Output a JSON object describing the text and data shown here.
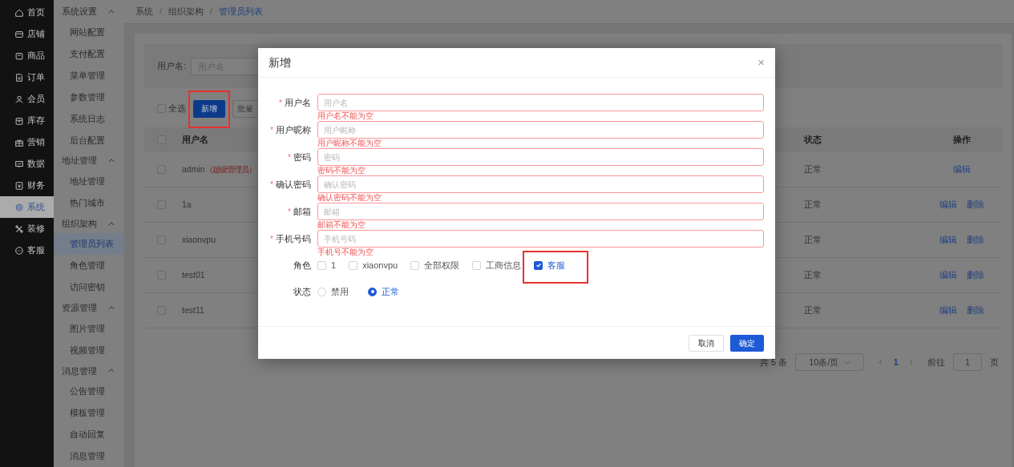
{
  "sidebar": {
    "items": [
      {
        "label": "首页",
        "selected": false
      },
      {
        "label": "店铺",
        "selected": false
      },
      {
        "label": "商品",
        "selected": false
      },
      {
        "label": "订单",
        "selected": false
      },
      {
        "label": "会员",
        "selected": false
      },
      {
        "label": "库存",
        "selected": false
      },
      {
        "label": "营销",
        "selected": false
      },
      {
        "label": "数据",
        "selected": false
      },
      {
        "label": "财务",
        "selected": false
      },
      {
        "label": "系统",
        "selected": true
      },
      {
        "label": "装修",
        "selected": false
      },
      {
        "label": "客服",
        "selected": false
      }
    ]
  },
  "submenu": {
    "groups": [
      {
        "label": "系统设置",
        "expanded": true,
        "items": [
          {
            "label": "网站配置",
            "selected": false
          },
          {
            "label": "支付配置",
            "selected": false
          },
          {
            "label": "菜单管理",
            "selected": false
          },
          {
            "label": "参数管理",
            "selected": false
          },
          {
            "label": "系统日志",
            "selected": false
          },
          {
            "label": "后台配置",
            "selected": false
          }
        ]
      },
      {
        "label": "地址管理",
        "expanded": true,
        "items": [
          {
            "label": "地址管理",
            "selected": false
          },
          {
            "label": "热门城市",
            "selected": false
          }
        ]
      },
      {
        "label": "组织架构",
        "expanded": true,
        "items": [
          {
            "label": "管理员列表",
            "selected": true
          },
          {
            "label": "角色管理",
            "selected": false
          },
          {
            "label": "访问密钥",
            "selected": false
          }
        ]
      },
      {
        "label": "资源管理",
        "expanded": true,
        "items": [
          {
            "label": "图片管理",
            "selected": false
          },
          {
            "label": "视频管理",
            "selected": false
          }
        ]
      },
      {
        "label": "消息管理",
        "expanded": true,
        "items": [
          {
            "label": "公告管理",
            "selected": false
          },
          {
            "label": "模板管理",
            "selected": false
          },
          {
            "label": "自动回复",
            "selected": false
          },
          {
            "label": "消息管理",
            "selected": false
          }
        ]
      }
    ]
  },
  "breadcrumb": [
    {
      "label": "系统",
      "selected": false
    },
    {
      "separator": "/",
      "label": "组织架构",
      "selected": false
    },
    {
      "separator": "/",
      "label": "管理员列表",
      "selected": true
    }
  ],
  "search": {
    "label": "用户名:",
    "placeholder": "用户名"
  },
  "toolbar": {
    "select_all": {
      "label": "全选",
      "checked": false
    },
    "buttons": [
      {
        "label": "新增",
        "kind": "primary",
        "highlighted": true
      },
      {
        "label": "批量",
        "kind": "default",
        "highlighted": false
      }
    ]
  },
  "table": {
    "header_checked": false,
    "columns": [
      "用户名",
      "状态",
      "操作"
    ],
    "rows": [
      {
        "checked": false,
        "username": "admin",
        "tag": "（超级管理员）",
        "status": "正常",
        "actions": [
          "编辑"
        ]
      },
      {
        "checked": false,
        "username": "1a",
        "status": "正常",
        "actions": [
          "编辑",
          "删除"
        ]
      },
      {
        "checked": false,
        "username": "xiaonvpu",
        "status": "正常",
        "actions": [
          "编辑",
          "删除"
        ]
      },
      {
        "checked": false,
        "username": "test01",
        "status": "正常",
        "actions": [
          "编辑",
          "删除"
        ]
      },
      {
        "checked": false,
        "username": "test11",
        "status": "正常",
        "actions": [
          "编辑",
          "删除"
        ]
      }
    ]
  },
  "pagination": {
    "total": "共 5 条",
    "page_size": "10条/页",
    "prev": "‹",
    "pages": [
      {
        "label": "1",
        "selected": true
      }
    ],
    "next": "›",
    "goto_label": "前往",
    "goto_value": "1",
    "page_suffix": "页"
  },
  "dialog": {
    "title": "新增",
    "close": "×",
    "fields": [
      {
        "required_mark": "*",
        "label": "用户名",
        "placeholder": "用户名",
        "error": "用户名不能为空"
      },
      {
        "required_mark": "*",
        "label": "用户昵称",
        "placeholder": "用户昵称",
        "error": "用户昵称不能为空"
      },
      {
        "required_mark": "*",
        "label": "密码",
        "placeholder": "密码",
        "error": "密码不能为空"
      },
      {
        "required_mark": "*",
        "label": "确认密码",
        "placeholder": "确认密码",
        "error": "确认密码不能为空"
      },
      {
        "required_mark": "*",
        "label": "邮箱",
        "placeholder": "邮箱",
        "error": "邮箱不能为空"
      },
      {
        "required_mark": "*",
        "label": "手机号码",
        "placeholder": "手机号码",
        "error": "手机号不能为空"
      }
    ],
    "roles": {
      "label": "角色",
      "options": [
        {
          "label": "1",
          "checked": false,
          "highlighted": false
        },
        {
          "label": "xiaonvpu",
          "checked": false,
          "highlighted": false
        },
        {
          "label": "全部权限",
          "checked": false,
          "highlighted": false
        },
        {
          "label": "工商信息",
          "checked": false,
          "highlighted": false
        },
        {
          "label": "客服",
          "checked": true,
          "highlighted": true
        }
      ]
    },
    "status": {
      "label": "状态",
      "options": [
        {
          "label": "禁用",
          "selected": false
        },
        {
          "label": "正常",
          "selected": true
        }
      ]
    },
    "buttons": [
      {
        "label": "取消",
        "kind": "default"
      },
      {
        "label": "确定",
        "kind": "primary"
      }
    ]
  }
}
